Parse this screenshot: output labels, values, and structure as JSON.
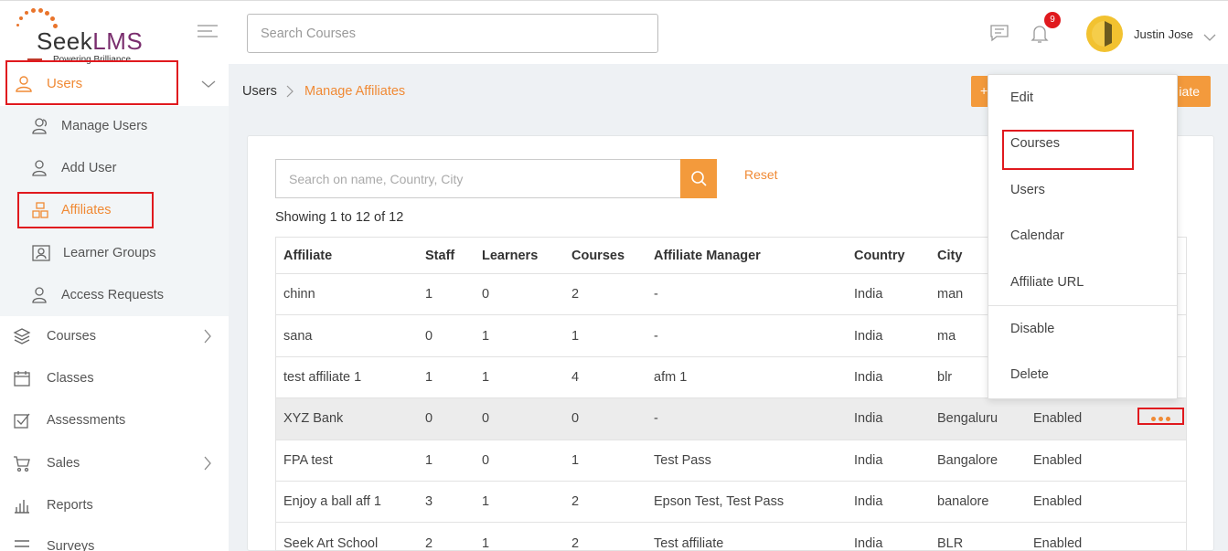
{
  "brand": {
    "name_part1": "Seek",
    "name_part2": "LMS",
    "tagline": "Powering Brilliance"
  },
  "header": {
    "search_placeholder": "Search Courses",
    "notification_count": "9",
    "user_name": "Justin Jose"
  },
  "sidebar": {
    "users": "Users",
    "sub": [
      {
        "label": "Manage Users"
      },
      {
        "label": "Add User"
      },
      {
        "label": "Affiliates"
      },
      {
        "label": "Learner Groups"
      },
      {
        "label": "Access Requests"
      }
    ],
    "items": [
      {
        "label": "Courses"
      },
      {
        "label": "Classes"
      },
      {
        "label": "Assessments"
      },
      {
        "label": "Sales"
      },
      {
        "label": "Reports"
      },
      {
        "label": "Surveys"
      }
    ]
  },
  "breadcrumb": {
    "root": "Users",
    "current": "Manage Affiliates"
  },
  "action_button": {
    "label": "iate"
  },
  "table_search": {
    "placeholder": "Search on name, Country, City",
    "reset": "Reset"
  },
  "showing": "Showing 1 to 12 of 12",
  "table": {
    "headers": [
      "Affiliate",
      "Staff",
      "Learners",
      "Courses",
      "Affiliate Manager",
      "Country",
      "City",
      "",
      ""
    ],
    "rows": [
      [
        "chinn",
        "1",
        "0",
        "2",
        "-",
        "India",
        "man",
        "",
        ""
      ],
      [
        "sana",
        "0",
        "1",
        "1",
        "-",
        "India",
        "ma",
        "",
        ""
      ],
      [
        "test affiliate 1",
        "1",
        "1",
        "4",
        "afm 1",
        "India",
        "blr",
        "",
        ""
      ],
      [
        "XYZ Bank",
        "0",
        "0",
        "0",
        "-",
        "India",
        "Bengaluru",
        "Enabled",
        ""
      ],
      [
        "FPA test",
        "1",
        "0",
        "1",
        "Test Pass",
        "India",
        "Bangalore",
        "Enabled",
        ""
      ],
      [
        "Enjoy a ball aff 1",
        "3",
        "1",
        "2",
        "Epson Test, Test Pass",
        "India",
        "banalore",
        "Enabled",
        ""
      ],
      [
        "Seek Art School",
        "2",
        "1",
        "2",
        "Test affiliate",
        "India",
        "BLR",
        "Enabled",
        ""
      ]
    ]
  },
  "menu": {
    "edit": "Edit",
    "courses": "Courses",
    "users": "Users",
    "calendar": "Calendar",
    "affiliate_url": "Affiliate URL",
    "disable": "Disable",
    "delete": "Delete"
  },
  "colors": {
    "accent": "#f08a35",
    "highlight_box": "#e0191e",
    "badge": "#e0191e"
  }
}
